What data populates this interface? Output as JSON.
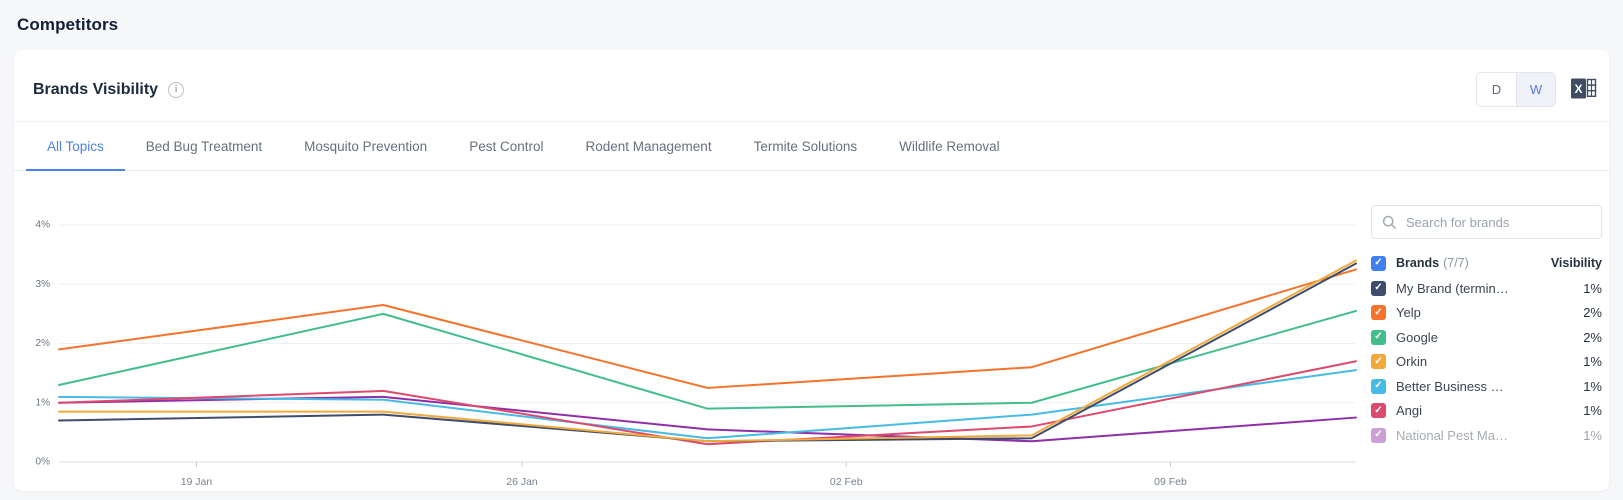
{
  "page": {
    "title": "Competitors"
  },
  "card": {
    "title": "Brands Visibility",
    "toggle": {
      "day_label": "D",
      "week_label": "W",
      "active": "W"
    },
    "tabs": [
      {
        "label": "All Topics",
        "active": true
      },
      {
        "label": "Bed Bug Treatment",
        "active": false
      },
      {
        "label": "Mosquito Prevention",
        "active": false
      },
      {
        "label": "Pest Control",
        "active": false
      },
      {
        "label": "Rodent Management",
        "active": false
      },
      {
        "label": "Termite Solutions",
        "active": false
      },
      {
        "label": "Wildlife Removal",
        "active": false
      }
    ]
  },
  "chart_data": {
    "type": "line",
    "title": "Brands Visibility",
    "ylim": [
      0,
      4
    ],
    "y_ticks": [
      "0%",
      "1%",
      "2%",
      "3%",
      "4%"
    ],
    "x_tick_labels": [
      "19 Jan",
      "26 Jan",
      "02 Feb",
      "09 Feb"
    ],
    "x_tick_fractions": [
      0.106,
      0.357,
      0.607,
      0.857
    ],
    "point_fractions": [
      0,
      0.25,
      0.5,
      0.75,
      1
    ],
    "grid": true,
    "legend_position": "right",
    "series": [
      {
        "name": "My Brand (termin…",
        "color": "#3e4d6b",
        "z": 6,
        "values": [
          0.7,
          0.8,
          0.35,
          0.4,
          3.35
        ]
      },
      {
        "name": "Yelp",
        "color": "#f4742c",
        "z": 5,
        "values": [
          1.9,
          2.65,
          1.25,
          1.6,
          3.25
        ]
      },
      {
        "name": "Google",
        "color": "#42bd8b",
        "z": 4,
        "values": [
          1.3,
          2.5,
          0.9,
          1.0,
          2.55
        ]
      },
      {
        "name": "Orkin",
        "color": "#f1a93c",
        "z": 7,
        "values": [
          0.85,
          0.85,
          0.35,
          0.45,
          3.4
        ]
      },
      {
        "name": "Better Business …",
        "color": "#46bbe5",
        "z": 2,
        "values": [
          1.1,
          1.05,
          0.4,
          0.8,
          1.55
        ]
      },
      {
        "name": "Angi",
        "color": "#dc4a6e",
        "z": 3,
        "values": [
          1.0,
          1.2,
          0.3,
          0.6,
          1.7
        ]
      },
      {
        "name": "National Pest Ma…",
        "color": "#8f2fa8",
        "z": 1,
        "values": [
          1.0,
          1.1,
          0.55,
          0.35,
          0.75
        ]
      }
    ]
  },
  "legend": {
    "search_placeholder": "Search for brands",
    "header": {
      "label": "Brands",
      "count": "(7/7)",
      "value_col": "Visibility",
      "checkbox_color": "#4080ee"
    },
    "rows": [
      {
        "label": "My Brand (termin…",
        "value": "1%",
        "color": "#3e4d6b",
        "checked": true,
        "faded": false
      },
      {
        "label": "Yelp",
        "value": "2%",
        "color": "#f4742c",
        "checked": true,
        "faded": false
      },
      {
        "label": "Google",
        "value": "2%",
        "color": "#42bd8b",
        "checked": true,
        "faded": false
      },
      {
        "label": "Orkin",
        "value": "1%",
        "color": "#f1a93c",
        "checked": true,
        "faded": false
      },
      {
        "label": "Better Business …",
        "value": "1%",
        "color": "#46bbe5",
        "checked": true,
        "faded": false
      },
      {
        "label": "Angi",
        "value": "1%",
        "color": "#dc4a6e",
        "checked": true,
        "faded": false
      },
      {
        "label": "National Pest Ma…",
        "value": "1%",
        "color": "#8f2fa8",
        "checked": true,
        "faded": true
      }
    ]
  },
  "colors": {
    "accent_blue": "#4c80ea",
    "axis_line": "#d9dde3",
    "grid_line": "#f0f1f4",
    "tick_mark": "#c8cdd4",
    "y_label": "#6b7581",
    "x_label": "#788290",
    "excel_icon": "#3f4c63"
  }
}
